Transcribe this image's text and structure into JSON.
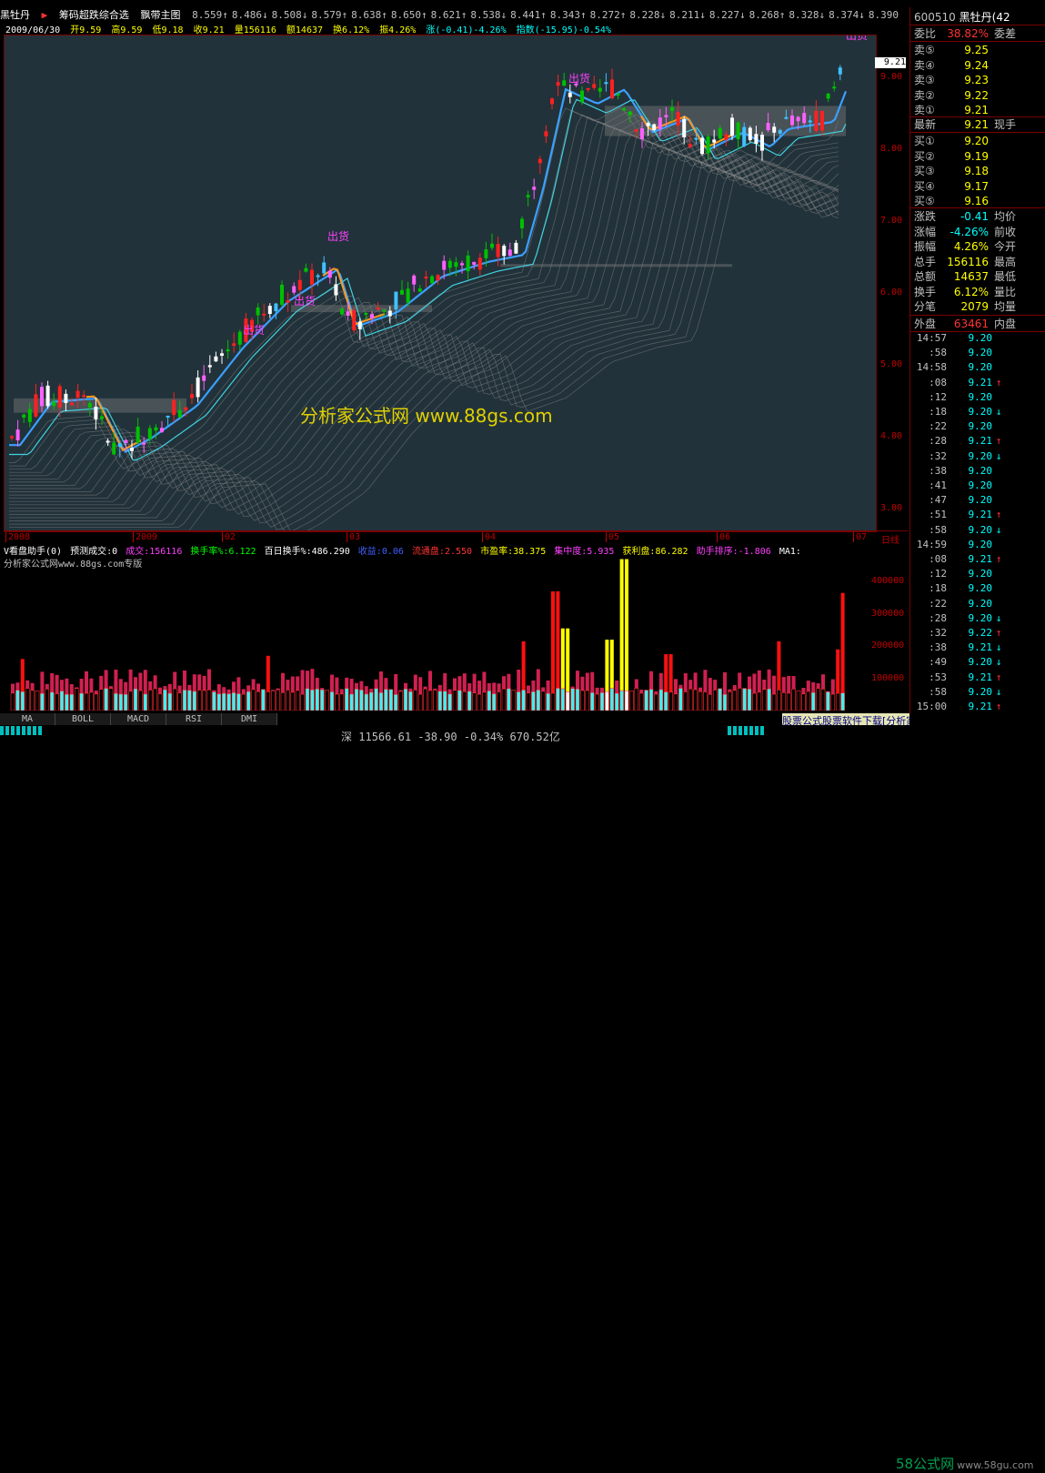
{
  "header": {
    "stock_name": "黑牡丹",
    "indicator_name": "筹码超跌综合选",
    "main_chart": "飘带主图",
    "ma_values": [
      "8.559↑",
      "8.486↓",
      "8.508↓",
      "8.579↑",
      "8.638↑",
      "8.650↑",
      "8.621↑",
      "8.538↓",
      "8.441↑",
      "8.343↑",
      "8.272↑",
      "8.228↓",
      "8.211↓",
      "8.227↓",
      "8.268↑",
      "8.328↓",
      "8.374↓",
      "8.390"
    ]
  },
  "ohlc": {
    "date": "2009/06/30",
    "open": "开9.59",
    "high": "高9.59",
    "low": "低9.18",
    "close": "收9.21",
    "volume": "量156116",
    "amount": "额14637",
    "turnover": "换6.12%",
    "amplitude": "振4.26%",
    "change": "涨(-0.41)-4.26%",
    "index_change": "指数(-15.95)-0.54%"
  },
  "chart_data": {
    "type": "candlestick",
    "y_ticks": [
      "9.00",
      "8.00",
      "7.00",
      "6.00",
      "5.00",
      "4.00",
      "3.00"
    ],
    "ylim": [
      2.7,
      9.6
    ],
    "x_ticks": [
      "2008",
      "2009",
      "02",
      "03",
      "04",
      "05",
      "06",
      "07"
    ],
    "axis_label_right": "日线",
    "current_price": "9.21",
    "annotation_sell": "出货",
    "watermark": "分析家公式网 www.88gs.com",
    "volume_ticks": [
      "400000",
      "300000",
      "200000",
      "100000"
    ],
    "vol_ylim": [
      0,
      480000
    ]
  },
  "indicator": {
    "name": "V看盘助手(0)",
    "pred_volume": "预测成交:0",
    "volume": "成交:156116",
    "turnover_rate": "换手率%:6.122",
    "hundred_day_turnover": "百日换手%:486.290",
    "earnings": "收益:0.06",
    "float_shares": "流通盘:2.550",
    "pe": "市盈率:38.375",
    "concentration": "集中度:5.935",
    "profit_ratio": "获利盘:86.282",
    "helper_rank": "助手排序:-1.806",
    "ma1": "MA1:",
    "sub_label": "分析家公式网www.88gs.com专版"
  },
  "tabs": [
    "MA",
    "BOLL",
    "MACD",
    "RSI",
    "DMI"
  ],
  "status": {
    "market": "深",
    "index": "11566.61",
    "change": "-38.90",
    "pct": "-0.34%",
    "amount": "670.52亿"
  },
  "promo": "股票公式股票软件下载[分析家公式网www.88gs.com]",
  "brand": {
    "name": "58公式网",
    "url": "www.58gu.com"
  },
  "quote": {
    "code": "600510",
    "name": "黑牡丹(42",
    "weibi_label": "委比",
    "weibi": "38.82%",
    "weicha_label": "委差",
    "asks": [
      {
        "label": "卖⑤",
        "price": "9.25"
      },
      {
        "label": "卖④",
        "price": "9.24"
      },
      {
        "label": "卖③",
        "price": "9.23"
      },
      {
        "label": "卖②",
        "price": "9.22"
      },
      {
        "label": "卖①",
        "price": "9.21"
      }
    ],
    "last_label": "最新",
    "last": "9.21",
    "last_right": "现手",
    "bids": [
      {
        "label": "买①",
        "price": "9.20"
      },
      {
        "label": "买②",
        "price": "9.19"
      },
      {
        "label": "买③",
        "price": "9.18"
      },
      {
        "label": "买④",
        "price": "9.17"
      },
      {
        "label": "买⑤",
        "price": "9.16"
      }
    ],
    "stats": [
      {
        "k": "涨跌",
        "v": "-0.41",
        "k2": "均价"
      },
      {
        "k": "涨幅",
        "v": "-4.26%",
        "k2": "前收"
      },
      {
        "k": "振幅",
        "v": "4.26%",
        "k2": "今开"
      },
      {
        "k": "总手",
        "v": "156116",
        "k2": "最高"
      },
      {
        "k": "总额",
        "v": "14637",
        "k2": "最低"
      },
      {
        "k": "换手",
        "v": "6.12%",
        "k2": "量比"
      },
      {
        "k": "分笔",
        "v": "2079",
        "k2": "均量"
      }
    ],
    "outer_label": "外盘",
    "outer": "63461",
    "inner_label": "内盘"
  },
  "ticks": [
    {
      "t": "14:57",
      "p": "9.20",
      "a": ""
    },
    {
      "t": ":58",
      "p": "9.20",
      "a": ""
    },
    {
      "t": "14:58",
      "p": "9.20",
      "a": ""
    },
    {
      "t": ":08",
      "p": "9.21",
      "a": "↑"
    },
    {
      "t": ":12",
      "p": "9.20",
      "a": ""
    },
    {
      "t": ":18",
      "p": "9.20",
      "a": "↓"
    },
    {
      "t": ":22",
      "p": "9.20",
      "a": ""
    },
    {
      "t": ":28",
      "p": "9.21",
      "a": "↑"
    },
    {
      "t": ":32",
      "p": "9.20",
      "a": "↓"
    },
    {
      "t": ":38",
      "p": "9.20",
      "a": ""
    },
    {
      "t": ":41",
      "p": "9.20",
      "a": ""
    },
    {
      "t": ":47",
      "p": "9.20",
      "a": ""
    },
    {
      "t": ":51",
      "p": "9.21",
      "a": "↑"
    },
    {
      "t": ":58",
      "p": "9.20",
      "a": "↓"
    },
    {
      "t": "14:59",
      "p": "9.20",
      "a": ""
    },
    {
      "t": ":08",
      "p": "9.21",
      "a": "↑"
    },
    {
      "t": ":12",
      "p": "9.20",
      "a": ""
    },
    {
      "t": ":18",
      "p": "9.20",
      "a": ""
    },
    {
      "t": ":22",
      "p": "9.20",
      "a": ""
    },
    {
      "t": ":28",
      "p": "9.20",
      "a": "↓"
    },
    {
      "t": ":32",
      "p": "9.22",
      "a": "↑"
    },
    {
      "t": ":38",
      "p": "9.21",
      "a": "↓"
    },
    {
      "t": ":49",
      "p": "9.20",
      "a": "↓"
    },
    {
      "t": ":53",
      "p": "9.21",
      "a": "↑"
    },
    {
      "t": ":58",
      "p": "9.20",
      "a": "↓"
    },
    {
      "t": "15:00",
      "p": "9.21",
      "a": "↑"
    }
  ]
}
